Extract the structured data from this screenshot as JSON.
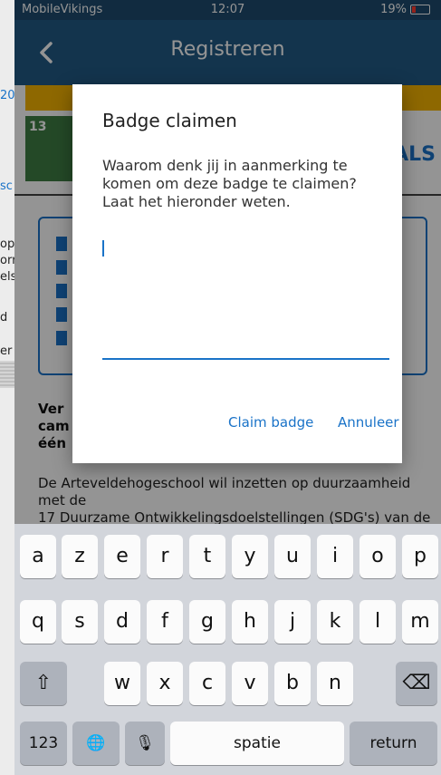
{
  "status_bar": {
    "carrier": "MobileVikings",
    "time": "12:07",
    "battery": "19%"
  },
  "nav": {
    "title": "Registreren"
  },
  "background": {
    "left_fragments": [
      "20",
      "sc",
      "op",
      "orr",
      "els",
      "d",
      "er"
    ],
    "sdg_tile_number": "13",
    "sdg_right_text": "ALS",
    "bold_lines": [
      "Ver",
      "cam",
      "één"
    ],
    "paragraph": [
      "De Arteveldehogeschool wil inzetten op duurzaamheid",
      "met de",
      "17 Duurzame Ontwikkelingsdoelstellingen (SDG's) van de"
    ]
  },
  "dialog": {
    "title": "Badge claimen",
    "message_lines": [
      "Waarom denk jij in aanmerking te",
      "komen om deze badge te claimen?",
      "Laat het hieronder weten."
    ],
    "input_value": "",
    "claim_label": "Claim badge",
    "cancel_label": "Annuleer"
  },
  "keyboard": {
    "row1": [
      "a",
      "z",
      "e",
      "r",
      "t",
      "y",
      "u",
      "i",
      "o",
      "p"
    ],
    "row2": [
      "q",
      "s",
      "d",
      "f",
      "g",
      "h",
      "j",
      "k",
      "l",
      "m"
    ],
    "row3": [
      "w",
      "x",
      "c",
      "v",
      "b",
      "n"
    ],
    "numbers_label": "123",
    "space_label": "spatie",
    "return_label": "return",
    "shift_icon": "⇧",
    "globe_icon": "🌐",
    "mic_icon": "🎙",
    "delete_icon": "⌫"
  }
}
